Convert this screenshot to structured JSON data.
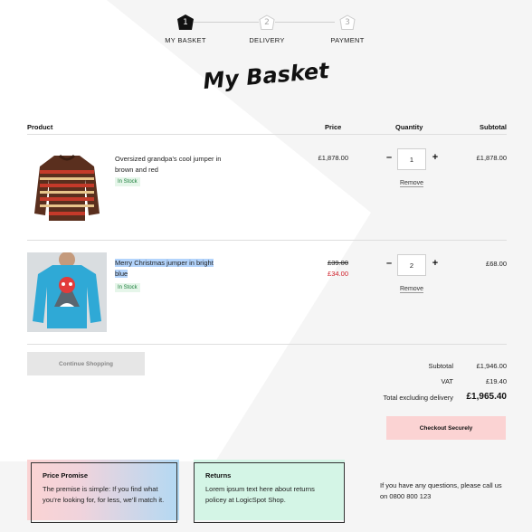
{
  "steps": [
    {
      "num": "1",
      "label": "MY BASKET",
      "active": true
    },
    {
      "num": "2",
      "label": "DELIVERY",
      "active": false
    },
    {
      "num": "3",
      "label": "PAYMENT",
      "active": false
    }
  ],
  "title": "My Basket",
  "table": {
    "headers": {
      "product": "Product",
      "price": "Price",
      "quantity": "Quantity",
      "subtotal": "Subtotal"
    }
  },
  "items": [
    {
      "name": "Oversized grandpa’s cool jumper in brown and red",
      "stock": "In Stock",
      "price": "£1,878.00",
      "quantity": "1",
      "minus": "–",
      "plus": "+",
      "remove": "Remove",
      "subtotal": "£1,878.00",
      "image": "brown-red-sweater"
    },
    {
      "name": "Merry Christmas jumper in bright blue",
      "stock": "In Stock",
      "old_price": "£39.00",
      "price": "£34.00",
      "quantity": "2",
      "minus": "–",
      "plus": "+",
      "remove": "Remove",
      "subtotal": "£68.00",
      "image": "blue-christmas-sweater"
    }
  ],
  "continue_label": "Continue Shopping",
  "totals": {
    "subtotal_label": "Subtotal",
    "subtotal": "£1,946.00",
    "vat_label": "VAT",
    "vat": "£19.40",
    "total_label": "Total excluding delivery",
    "total": "£1,965.40"
  },
  "checkout_label": "Checkout Securely",
  "cards": [
    {
      "title": "Price Promise",
      "text": "The premise is simple: If you find what you’re looking for, for less, we’ll match it."
    },
    {
      "title": "Returns",
      "text": "Lorem ipsum text here about returns policey at LogicSpot Shop."
    }
  ],
  "help_text": "If you have any questions, please call us on 0800 800 123",
  "colors": {
    "accent_pink": "#fbd3d3",
    "accent_blue": "#b3d4fc",
    "accent_green": "#d4f5e6",
    "sale_red": "#d0202a"
  }
}
